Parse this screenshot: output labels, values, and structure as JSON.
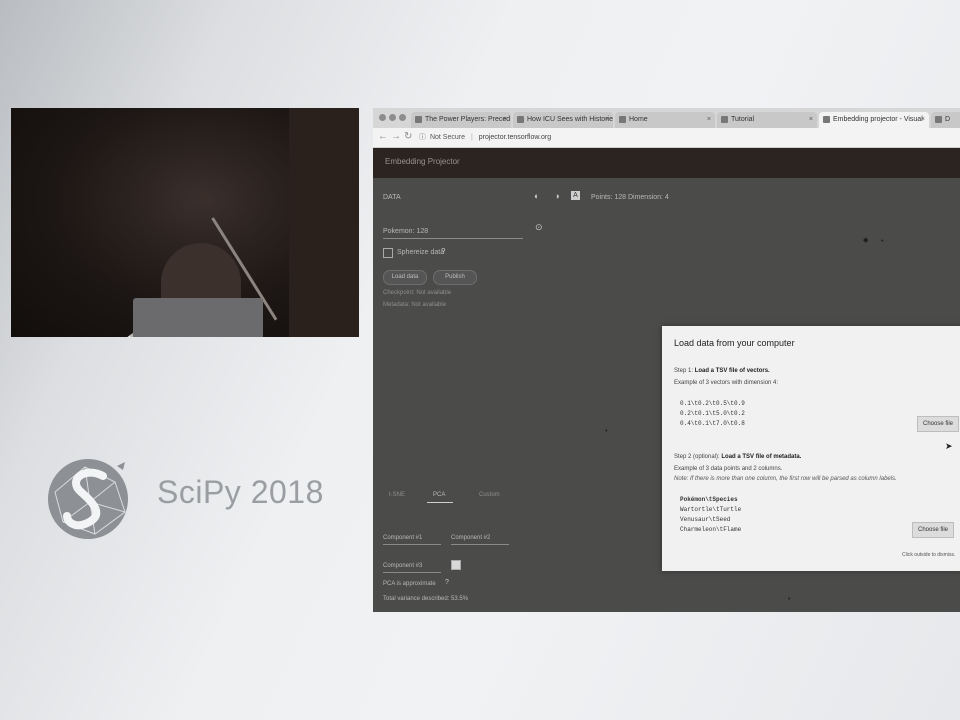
{
  "slide": {
    "logo_text": "SciPy 2018"
  },
  "browser": {
    "tabs": [
      {
        "label": "The Power Players: Preced"
      },
      {
        "label": "How ICU Sees with Historie"
      },
      {
        "label": "Home"
      },
      {
        "label": "Tutorial"
      },
      {
        "label": "Embedding projector - Visual"
      },
      {
        "label": "D"
      }
    ],
    "active_tab_index": 4,
    "address": {
      "security": "Not Secure",
      "url": "projector.tensorflow.org"
    }
  },
  "app": {
    "title": "Embedding Projector",
    "data_label": "DATA",
    "points_info": "Points: 128  Dimension: 4",
    "tensor_label": "Pokemon: 128",
    "sphereize_label": "Sphereize data",
    "buttons": {
      "load": "Load data",
      "publish": "Publish"
    },
    "checkpoint_label": "Checkpoint:  Not available",
    "metadata_label": "Metadata:  Not available",
    "projection_tabs": [
      "t-SNE",
      "PCA",
      "Custom"
    ],
    "x_component": "Component #1",
    "y_component": "Component #2",
    "z_component": "Component #3",
    "pca_note": "PCA is approximate",
    "variance": "Total variance described: 53.5%"
  },
  "dialog": {
    "title": "Load data from your computer",
    "step1_prefix": "Step 1:",
    "step1_bold": "Load a TSV file of vectors.",
    "step1_example": "Example of 3 vectors with dimension 4:",
    "vectors": [
      "0.1\\t0.2\\t0.5\\t0.9",
      "0.2\\t0.1\\t5.0\\t0.2",
      "0.4\\t0.1\\t7.0\\t0.8"
    ],
    "choose_file": "Choose file",
    "step2_prefix": "Step 2 (optional):",
    "step2_bold": "Load a TSV file of metadata.",
    "step2_example": "Example of 3 data points and 2 columns.",
    "step2_note": "Note: If there is more than one column, the first row will be parsed as column labels.",
    "metadata_rows": [
      "Pokémon\\tSpecies",
      "Wartortle\\tTurtle",
      "Venusaur\\tSeed",
      "Charmeleon\\tFlame"
    ],
    "footer": "Click outside to dismiss."
  },
  "colors": {
    "app_header": "#2c2421",
    "app_body": "#4b4b4a",
    "dialog_bg": "#f1f1f1"
  }
}
